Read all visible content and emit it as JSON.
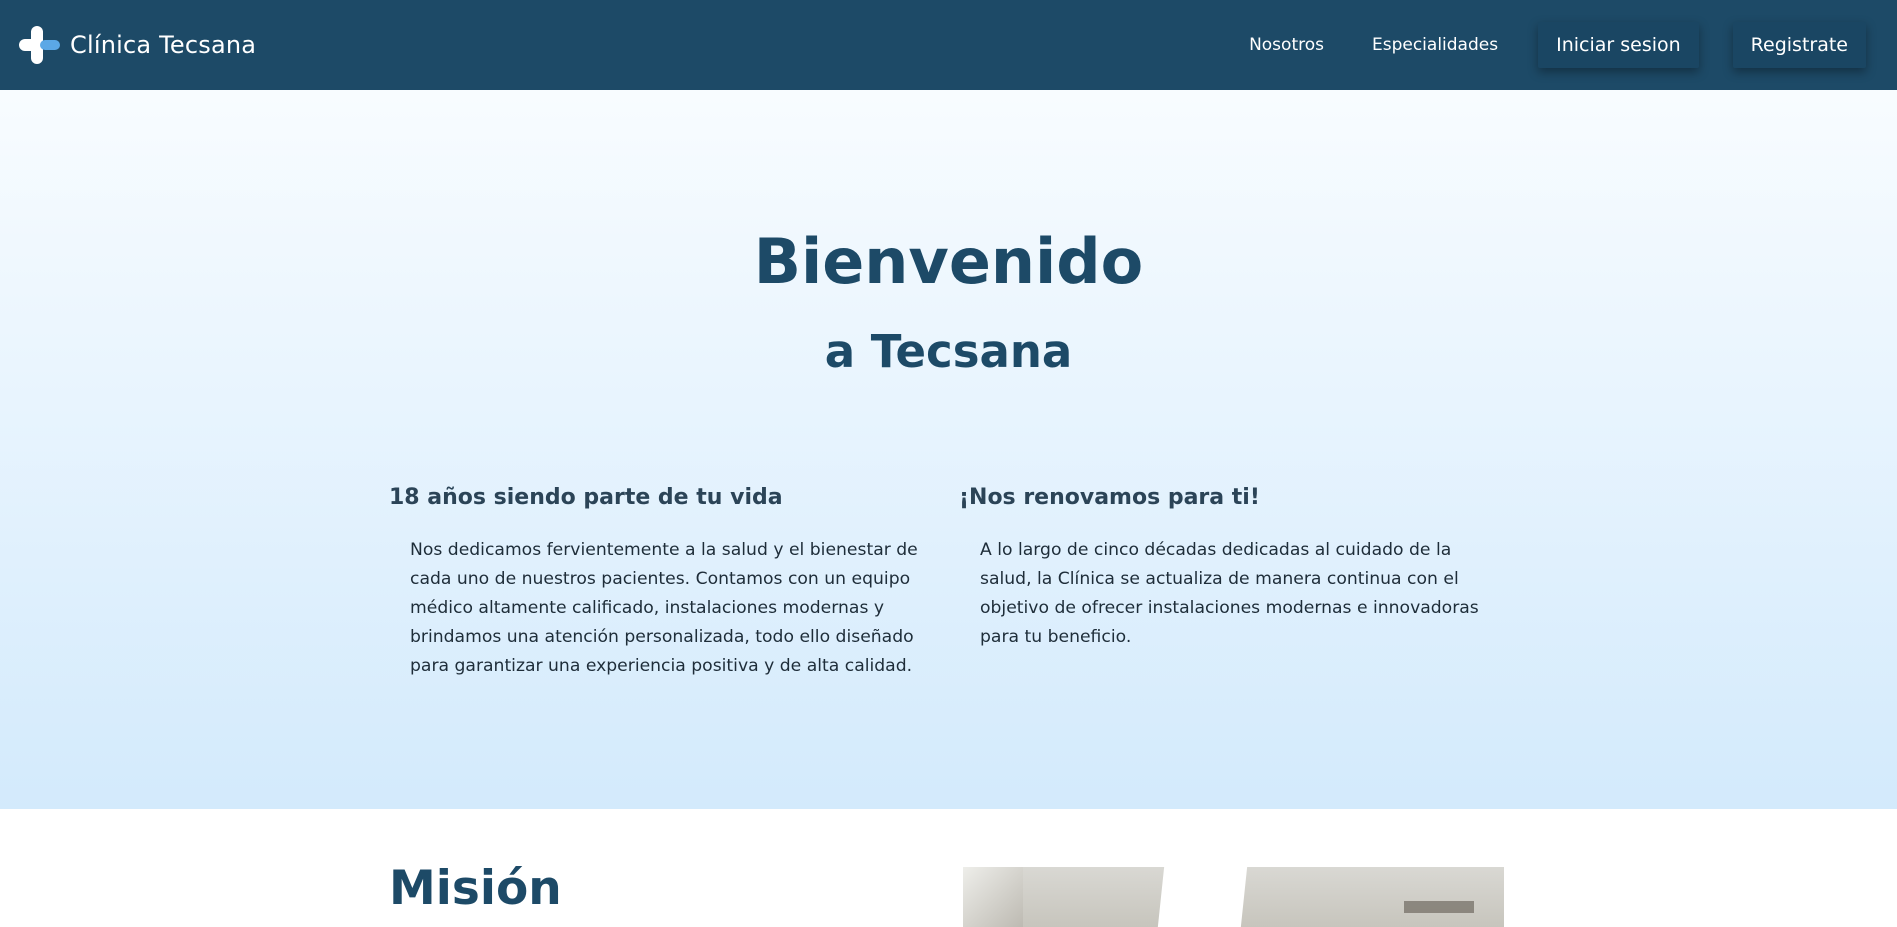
{
  "header": {
    "brand": "Clínica Tecsana",
    "logo_icon": "medical-cross-icon",
    "colors": {
      "bar": "#1d4a67",
      "text": "#ffffff",
      "logo_light": "#ffffff",
      "logo_accent": "#5ba8e6"
    },
    "nav": {
      "about": "Nosotros",
      "specialties": "Especialidades",
      "login": "Iniciar sesion",
      "register": "Registrate"
    }
  },
  "hero": {
    "title": "Bienvenido",
    "subtitle": "a Tecsana",
    "colors": {
      "gradient_top": "#f8fcff",
      "gradient_bottom": "#d3eafc"
    },
    "columns": [
      {
        "heading": "18 años siendo parte de tu vida",
        "text": "Nos dedicamos fervientemente a la salud y el bienestar de cada uno de nuestros pacientes. Contamos con un equipo médico altamente calificado, instalaciones modernas y brindamos una atención personalizada, todo ello diseñado para garantizar una experiencia positiva y de alta calidad."
      },
      {
        "heading": "¡Nos renovamos para ti!",
        "text": "A lo largo de cinco décadas dedicadas al cuidado de la salud, la Clínica se actualiza de manera continua con el objetivo de ofrecer instalaciones modernas e innovadoras para tu beneficio."
      }
    ]
  },
  "mission": {
    "title": "Misión"
  }
}
